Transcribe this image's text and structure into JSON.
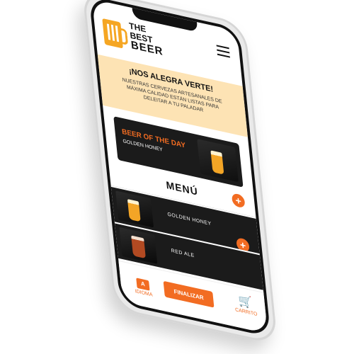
{
  "logo": {
    "line1": "THE",
    "line2": "BEST",
    "line3": "BEER"
  },
  "welcome": {
    "heading": "¡NOS ALEGRA VERTE!",
    "text": "NUESTRAS CERVEZAS ARTESANALES DE MÁXIMA CALIDAD ESTÁN LISTAS PARA DELEITAR A TU PALADAR"
  },
  "beer_of_the_day": {
    "title": "BEER OF THE DAY",
    "name": "GOLDEN HONEY"
  },
  "menu": {
    "title": "MENÚ",
    "add_symbol": "+",
    "items": [
      {
        "name": "GOLDEN HONEY"
      },
      {
        "name": "RED ALE"
      }
    ]
  },
  "bottom": {
    "language_badge": "A",
    "language_label": "IDIOMA",
    "finalize_label": "FINALIZAR",
    "cart_label": "CARRITO"
  },
  "colors": {
    "accent": "#f26c22",
    "logo": "#f5a623",
    "welcome_bg": "#fde3b4",
    "dark": "#1b1b1b"
  },
  "icons": {
    "menu": "hamburger-icon",
    "cart": "cart-icon",
    "language": "translate-icon",
    "add": "plus-icon"
  }
}
